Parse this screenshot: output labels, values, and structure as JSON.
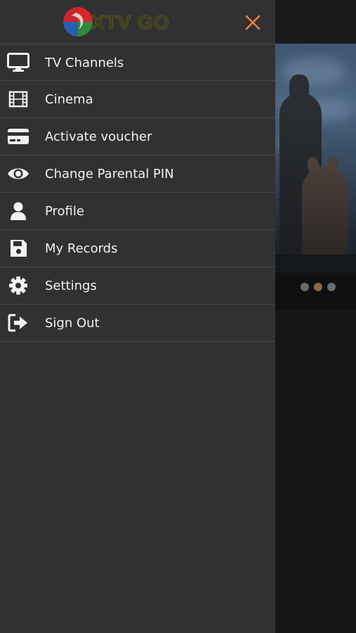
{
  "app": {
    "brand_text": "XTV GO"
  },
  "drawer": {
    "close_icon": "close-icon",
    "items": [
      {
        "label": "TV Channels",
        "icon": "monitor-icon"
      },
      {
        "label": "Cinema",
        "icon": "film-icon"
      },
      {
        "label": "Activate voucher",
        "icon": "credit-card-icon"
      },
      {
        "label": "Change Parental PIN",
        "icon": "eye-icon"
      },
      {
        "label": "Profile",
        "icon": "user-icon"
      },
      {
        "label": "My Records",
        "icon": "save-icon"
      },
      {
        "label": "Settings",
        "icon": "gear-icon"
      },
      {
        "label": "Sign Out",
        "icon": "sign-out-icon"
      }
    ]
  },
  "background": {
    "carousel": {
      "page_count": 3,
      "active_index": 1
    }
  },
  "colors": {
    "drawer_bg": "#313133",
    "accent_close": "#e8843a",
    "divider": "#4a4a4d",
    "text": "#f2f2f2"
  }
}
